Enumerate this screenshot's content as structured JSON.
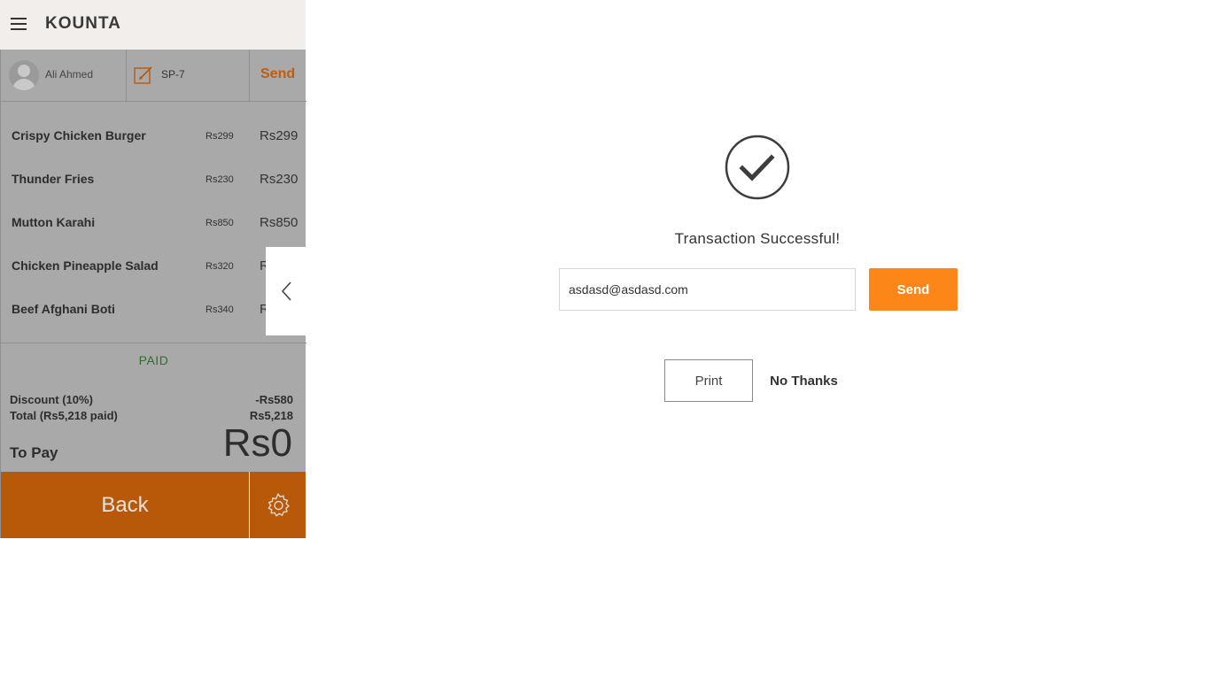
{
  "app": {
    "logo": "KOUNTA"
  },
  "customer": {
    "name": "Ali Ahmed",
    "order_id": "SP-7",
    "send_label": "Send"
  },
  "order_items": [
    {
      "name": "Crispy Chicken Burger",
      "unit_price": "Rs299",
      "total": "Rs299"
    },
    {
      "name": "Thunder Fries",
      "unit_price": "Rs230",
      "total": "Rs230"
    },
    {
      "name": "Mutton Karahi",
      "unit_price": "Rs850",
      "total": "Rs850"
    },
    {
      "name": "Chicken Pineapple Salad",
      "unit_price": "Rs320",
      "total": "R"
    },
    {
      "name": "Beef Afghani Boti",
      "unit_price": "Rs340",
      "total": "R"
    }
  ],
  "summary": {
    "status": "PAID",
    "discount_label": "Discount (10%)",
    "discount_value": "-Rs580",
    "total_label": "Total (Rs5,218 paid)",
    "total_value": "Rs5,218",
    "to_pay_label": "To Pay",
    "to_pay_value": "Rs0"
  },
  "footer": {
    "back_label": "Back"
  },
  "receipt": {
    "message": "Transaction Successful!",
    "email_value": "asdasd@asdasd.com",
    "send_label": "Send",
    "print_label": "Print",
    "no_thanks_label": "No Thanks"
  },
  "colors": {
    "accent": "#fd8619",
    "back_button": "#b8590a",
    "paid": "#2f6e2f"
  }
}
